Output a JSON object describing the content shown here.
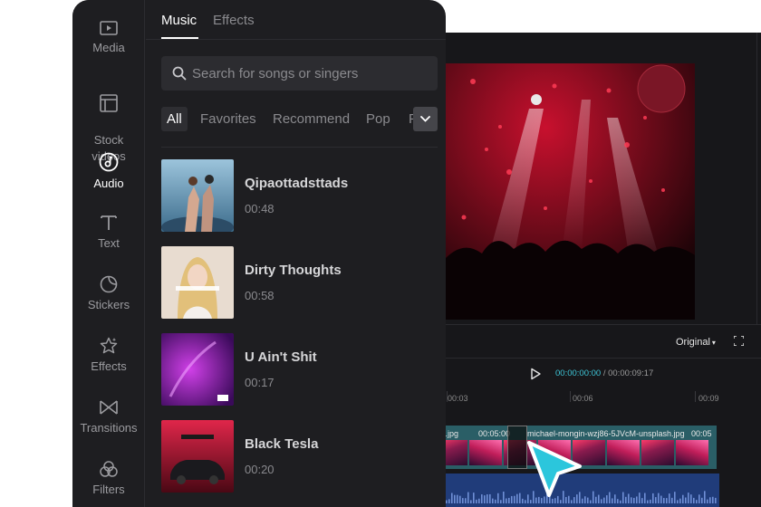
{
  "panel": {
    "sidebar": {
      "items": [
        {
          "label": "Media",
          "icon": "media-icon"
        },
        {
          "label": "Stock\nvideos",
          "icon": "stock-videos-icon"
        },
        {
          "label": "Audio",
          "icon": "audio-icon",
          "active": true
        },
        {
          "label": "Text",
          "icon": "text-icon"
        },
        {
          "label": "Stickers",
          "icon": "stickers-icon"
        },
        {
          "label": "Effects",
          "icon": "effects-icon"
        },
        {
          "label": "Transitions",
          "icon": "transitions-icon"
        },
        {
          "label": "Filters",
          "icon": "filters-icon"
        }
      ]
    },
    "tabs": [
      {
        "label": "Music",
        "active": true
      },
      {
        "label": "Effects",
        "active": false
      }
    ],
    "search": {
      "placeholder": "Search for songs or singers",
      "value": ""
    },
    "filters": [
      "All",
      "Favorites",
      "Recommend",
      "Pop",
      "F"
    ],
    "active_filter": "All",
    "songs": [
      {
        "title": "Qipaottadsttads",
        "duration": "00:48"
      },
      {
        "title": "Dirty Thoughts",
        "duration": "00:58"
      },
      {
        "title": "U Ain't Shit",
        "duration": "00:17"
      },
      {
        "title": "Black Tesla",
        "duration": "00:20"
      }
    ]
  },
  "editor": {
    "ratio_label": "Original",
    "current_time": "00:00:00:00",
    "separator": " / ",
    "total_time": "00:00:09:17",
    "ticks": [
      "00:03",
      "00:06",
      "00:09"
    ],
    "video_track": {
      "label_left": "sh.jpg",
      "duration": "00:05:00",
      "label_main": "michael-mongin-wzj86-5JVcM-unsplash.jpg",
      "duration_right": "00:05"
    }
  },
  "colors": {
    "accent": "#3ec6d8",
    "panel_bg": "#1e1e21",
    "editor_bg": "#17171a",
    "video_track": "#2a5e66",
    "audio_track": "#203c7a",
    "cursor": "#27c4d8"
  }
}
